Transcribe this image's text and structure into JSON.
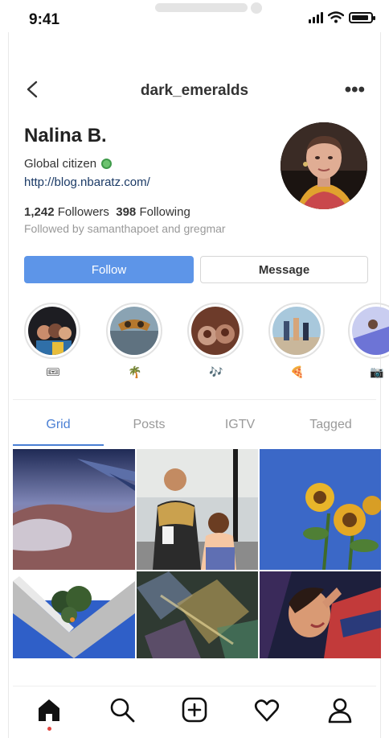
{
  "status_bar": {
    "time": "9:41"
  },
  "header": {
    "username": "dark_emeralds",
    "more_label": "•••"
  },
  "profile": {
    "name": "Nalina B.",
    "bio": "Global citizen",
    "link": "http://blog.nbaratz.com/",
    "followers_count": "1,242",
    "followers_label": "Followers",
    "following_count": "398",
    "following_label": "Following",
    "followed_by": "Followed by samanthapoet and gregmar"
  },
  "buttons": {
    "follow": "Follow",
    "message": "Message"
  },
  "highlights": [
    {
      "emoji": "🎟"
    },
    {
      "emoji": "🌴"
    },
    {
      "emoji": "🎶"
    },
    {
      "emoji": "🍕"
    },
    {
      "emoji": "📷"
    }
  ],
  "tabs": [
    {
      "label": "Grid",
      "active": true
    },
    {
      "label": "Posts",
      "active": false
    },
    {
      "label": "IGTV",
      "active": false
    },
    {
      "label": "Tagged",
      "active": false
    }
  ],
  "bottom_nav": [
    "home-icon",
    "search-icon",
    "add-post-icon",
    "heart-icon",
    "profile-icon"
  ],
  "colors": {
    "accent": "#5d95e8",
    "tab_active": "#4a7fd4",
    "notification_dot": "#e0463f"
  }
}
